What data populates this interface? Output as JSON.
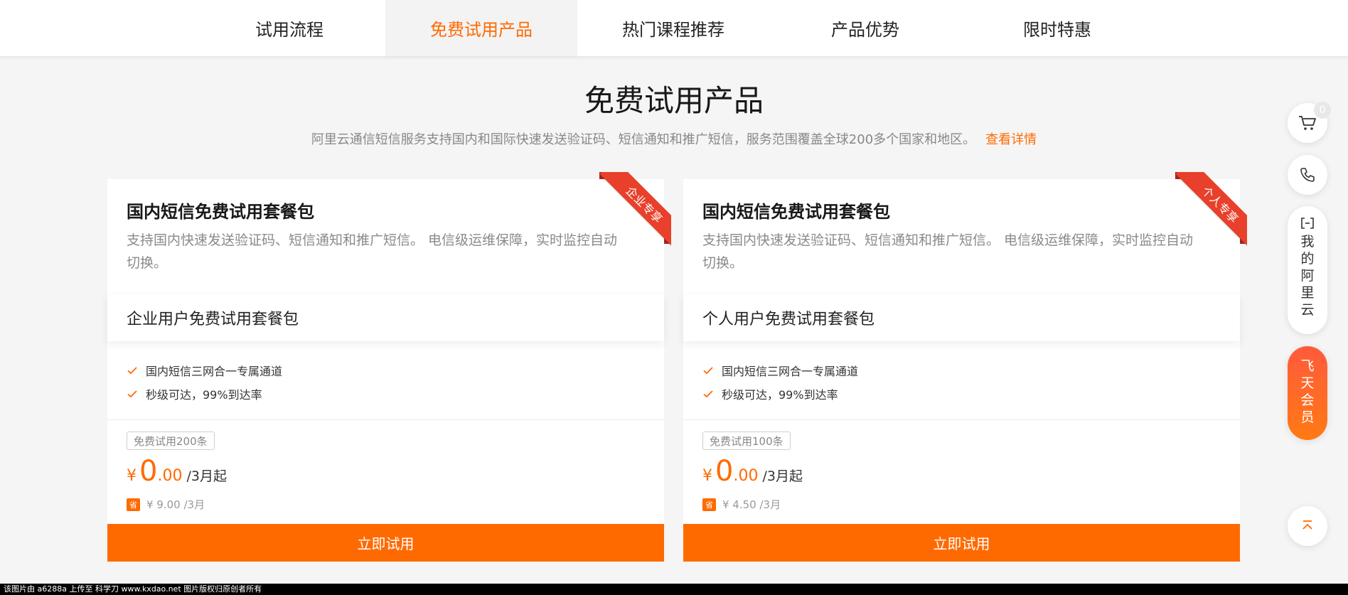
{
  "nav": {
    "tabs": [
      {
        "label": "试用流程"
      },
      {
        "label": "免费试用产品"
      },
      {
        "label": "热门课程推荐"
      },
      {
        "label": "产品优势"
      },
      {
        "label": "限时特惠"
      }
    ],
    "active_index": 1
  },
  "section": {
    "title": "免费试用产品",
    "description": "阿里云通信短信服务支持国内和国际快速发送验证码、短信通知和推广短信，服务范围覆盖全球200多个国家和地区。",
    "detail_link": "查看详情"
  },
  "cards": [
    {
      "ribbon": "企业专享",
      "title": "国内短信免费试用套餐包",
      "description": "支持国内快速发送验证码、短信通知和推广短信。 电信级运维保障，实时监控自动切换。",
      "plan": "企业用户免费试用套餐包",
      "features": [
        "国内短信三网合一专属通道",
        "秒级可达，99%到达率"
      ],
      "quota": "免费试用200条",
      "price_currency": "¥",
      "price_int": "0",
      "price_dec": ".00",
      "price_unit": "/3月起",
      "save_badge": "省",
      "save_text": "¥ 9.00 /3月",
      "cta": "立即试用"
    },
    {
      "ribbon": "个人专享",
      "title": "国内短信免费试用套餐包",
      "description": "支持国内快速发送验证码、短信通知和推广短信。 电信级运维保障，实时监控自动切换。",
      "plan": "个人用户免费试用套餐包",
      "features": [
        "国内短信三网合一专属通道",
        "秒级可达，99%到达率"
      ],
      "quota": "免费试用100条",
      "price_currency": "¥",
      "price_int": "0",
      "price_dec": ".00",
      "price_unit": "/3月起",
      "save_badge": "省",
      "save_text": "¥ 4.50 /3月",
      "cta": "立即试用"
    }
  ],
  "sidebar": {
    "cart_count": "0",
    "cart_icon": "cart-icon",
    "phone_icon": "phone-icon",
    "mine_icon": "aliyun-logo-icon",
    "mine_label": "我的阿里云",
    "vip_label": "飞天会员",
    "top_icon": "back-to-top-icon"
  },
  "watermark": "该图片由 a6288a 上传至 科学刀 www.kxdao.net 图片版权归原创者所有",
  "colors": {
    "accent": "#ff6a00",
    "ribbon": "#e8402b",
    "page_bg": "#f5f5f5"
  }
}
